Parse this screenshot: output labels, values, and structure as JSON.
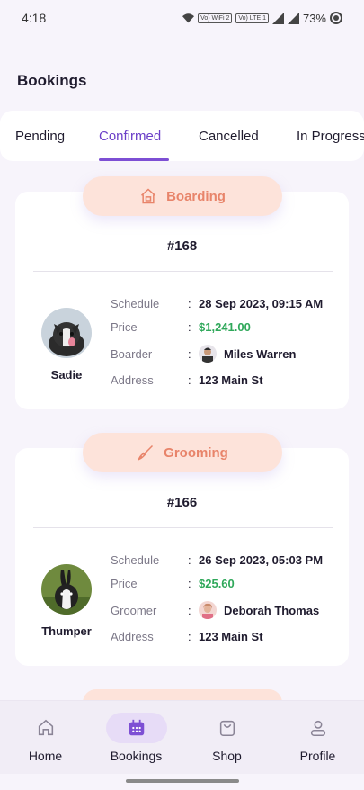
{
  "status_bar": {
    "time": "4:18",
    "battery": "73%",
    "badge1": "Vo) WiFi 2",
    "badge2": "Vo) LTE 1"
  },
  "page": {
    "title": "Bookings"
  },
  "tabs": [
    {
      "label": "Pending"
    },
    {
      "label": "Confirmed"
    },
    {
      "label": "Cancelled"
    },
    {
      "label": "In Progress"
    }
  ],
  "active_tab": "Confirmed",
  "labels": {
    "schedule": "Schedule",
    "price": "Price",
    "address": "Address",
    "colon": ":"
  },
  "bookings": [
    {
      "service": "Boarding",
      "id": "#168",
      "pet_name": "Sadie",
      "schedule": "28 Sep 2023, 09:15 AM",
      "price": "$1,241.00",
      "provider_role": "Boarder",
      "provider_name": "Miles Warren",
      "address": "123 Main St"
    },
    {
      "service": "Grooming",
      "id": "#166",
      "pet_name": "Thumper",
      "schedule": "26 Sep 2023, 05:03 PM",
      "price": "$25.60",
      "provider_role": "Groomer",
      "provider_name": "Deborah Thomas",
      "address": "123 Main St"
    }
  ],
  "colors": {
    "accent": "#6b3fc8",
    "price": "#2fa85a",
    "pill_bg": "#fde3da",
    "pill_text": "#e8846a"
  },
  "nav": [
    {
      "label": "Home",
      "icon": "home-icon"
    },
    {
      "label": "Bookings",
      "icon": "calendar-icon"
    },
    {
      "label": "Shop",
      "icon": "shopping-bag-icon"
    },
    {
      "label": "Profile",
      "icon": "person-icon"
    }
  ],
  "active_nav": "Bookings"
}
